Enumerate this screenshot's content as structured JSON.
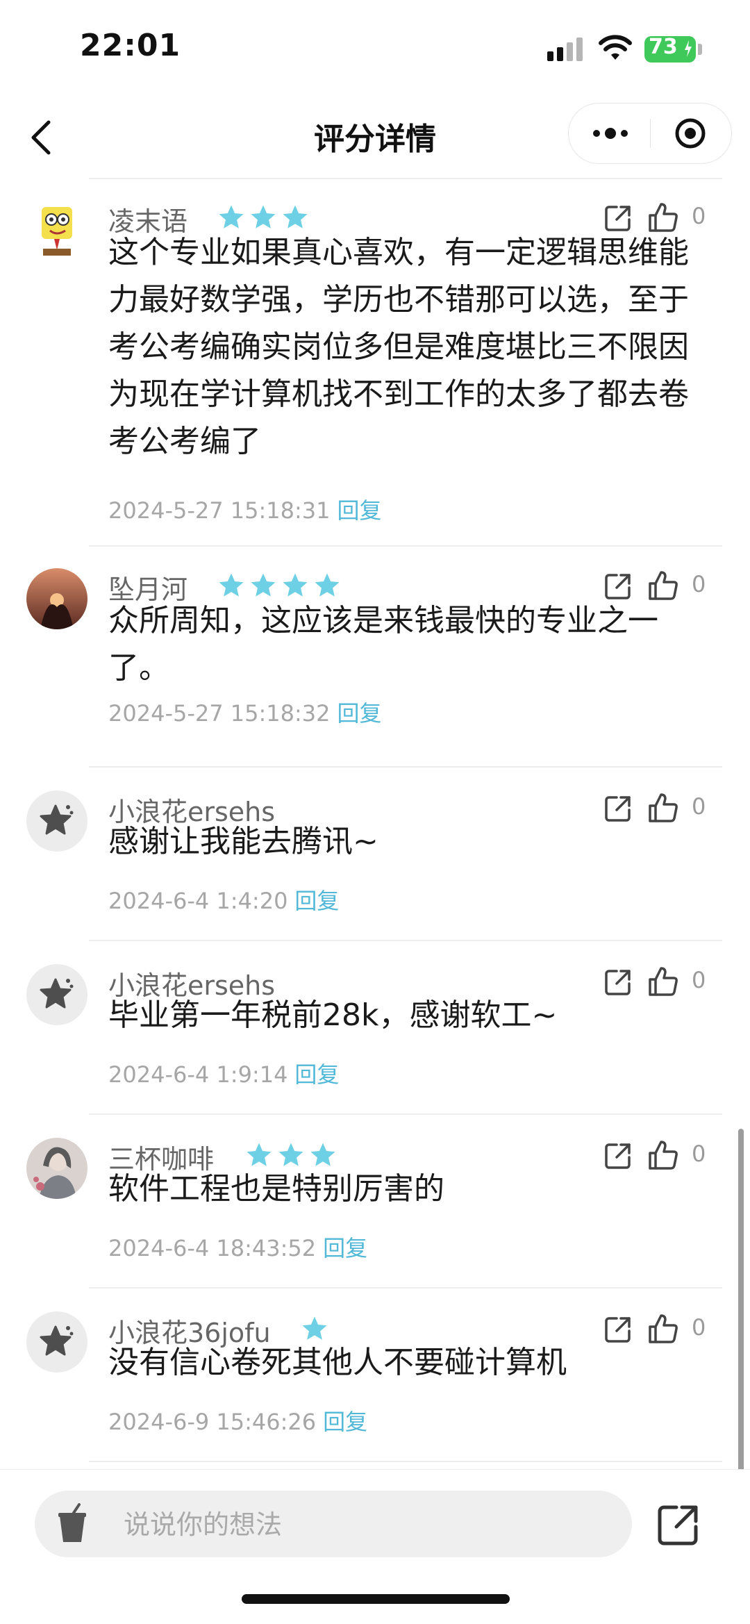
{
  "status_bar": {
    "time": "22:01",
    "battery": "73"
  },
  "nav": {
    "title": "评分详情"
  },
  "comments": [
    {
      "username": "凌末语",
      "stars": 3,
      "text": "这个专业如果真心喜欢，有一定逻辑思维能力最好数学强，学历也不错那可以选，至于考公考编确实岗位多但是难度堪比三不限因为现在学计算机找不到工作的太多了都去卷考公考编了",
      "time": "2024-5-27 15:18:31",
      "likes": "0",
      "avatar": "sponge-avatar"
    },
    {
      "username": "坠月河",
      "stars": 4,
      "text": "众所周知，这应该是来钱最快的专业之一了。",
      "time": "2024-5-27 15:18:32",
      "likes": "0",
      "avatar": "sunset-avatar"
    },
    {
      "username": "小浪花ersehs",
      "stars": 0,
      "text": "感谢让我能去腾讯~",
      "time": "2024-6-4 1:4:20",
      "likes": "0",
      "avatar": "default-star-avatar"
    },
    {
      "username": "小浪花ersehs",
      "stars": 0,
      "text": "毕业第一年税前28k，感谢软工~",
      "time": "2024-6-4 1:9:14",
      "likes": "0",
      "avatar": "default-star-avatar"
    },
    {
      "username": "三杯咖啡",
      "stars": 3,
      "text": "软件工程也是特别厉害的",
      "time": "2024-6-4 18:43:52",
      "likes": "0",
      "avatar": "portrait-avatar"
    },
    {
      "username": "小浪花36jofu",
      "stars": 1,
      "text": "没有信心卷死其他人不要碰计算机",
      "time": "2024-6-9 15:46:26",
      "likes": "0",
      "avatar": "default-star-avatar"
    }
  ],
  "reply_label": "回复",
  "input": {
    "placeholder": "说说你的想法"
  },
  "colors": {
    "star": "#6dd0e4",
    "reply": "#52b8d8",
    "battery": "#3ec95a"
  }
}
